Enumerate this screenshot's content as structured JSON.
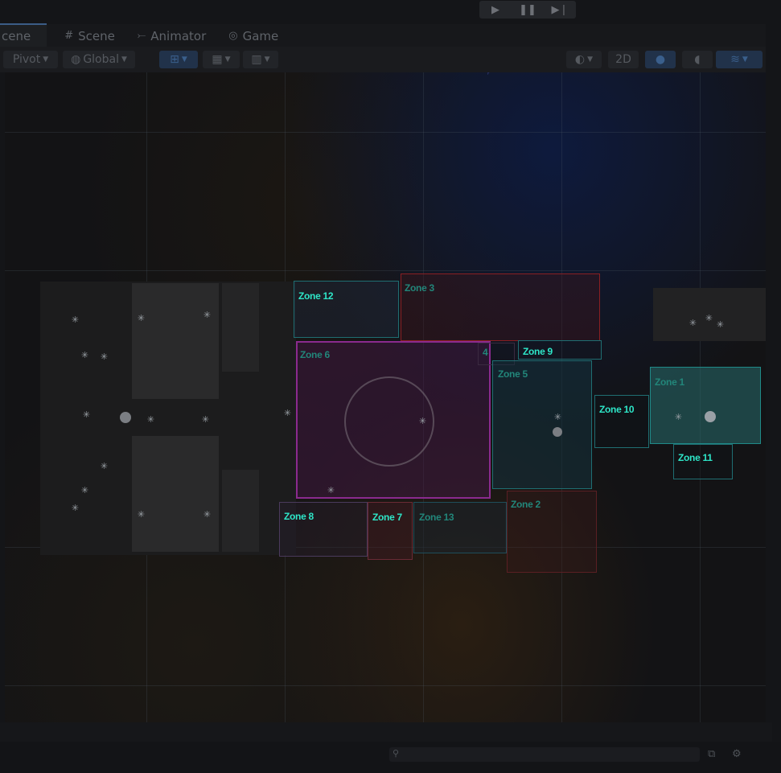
{
  "tabs": [
    {
      "label": "cene",
      "icon": "scene-grid-icon",
      "active": true
    },
    {
      "label": "Scene",
      "icon": "scene-grid-icon",
      "active": false
    },
    {
      "label": "Animator",
      "icon": "animator-icon",
      "active": false
    },
    {
      "label": "Game",
      "icon": "gamepad-icon",
      "active": false
    }
  ],
  "toolbar": {
    "pivot": "Pivot",
    "global": "Global",
    "mode_2d": "2D"
  },
  "zones": {
    "z1": "Zone 1",
    "z2": "Zone 2",
    "z3": "Zone 3",
    "z4": "4",
    "z5": "Zone 5",
    "z6": "Zone 6",
    "z7": "Zone 7",
    "z8": "Zone 8",
    "z9": "Zone 9",
    "z10": "Zone 10",
    "z11": "Zone 11",
    "z12": "Zone 12",
    "z13": "Zone 13"
  },
  "colors": {
    "zone_label": "#2ee6c8",
    "zone_label_dim": "#22867a",
    "zone3_border": "#8a1f23",
    "zone6_border": "#8a2a8e",
    "teal_border": "#1f6e72"
  }
}
